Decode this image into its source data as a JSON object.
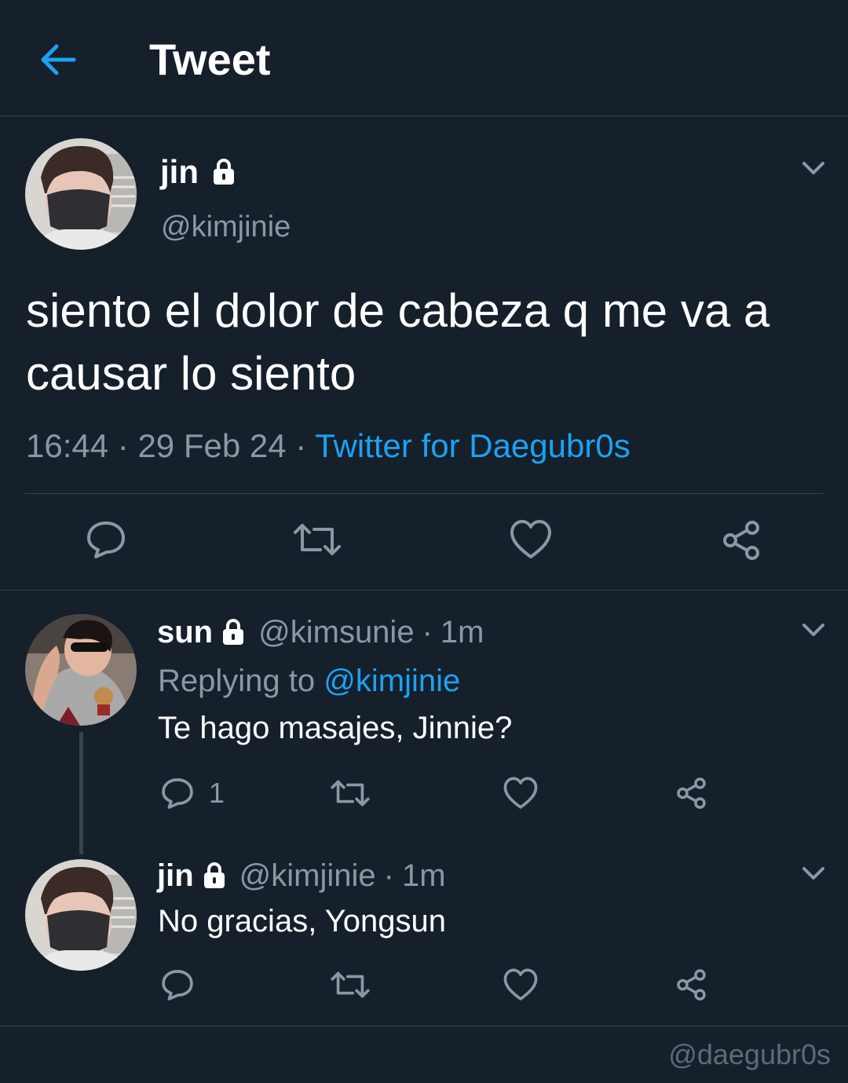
{
  "header": {
    "title": "Tweet",
    "back_icon": "arrow-left-icon",
    "accent_color": "#1da1f2"
  },
  "main_tweet": {
    "display_name": "jin",
    "handle": "@kimjinie",
    "protected_icon": "lock-icon",
    "text_line1": "siento el dolor de cabeza q me va a",
    "text_line2": "causar lo siento",
    "time": "16:44",
    "date": "29 Feb 24",
    "source": "Twitter for Daegubr0s",
    "separator": "·"
  },
  "replies": [
    {
      "display_name": "sun",
      "handle": "@kimsunie",
      "age": "1m",
      "replying_prefix": "Replying to",
      "replying_to": "@kimjinie",
      "text": "Te hago masajes, Jinnie?",
      "reply_count": "1"
    },
    {
      "display_name": "jin",
      "handle": "@kimjinie",
      "age": "1m",
      "text": "No gracias, Yongsun"
    }
  ],
  "watermark": "@daegubr0s",
  "colors": {
    "background": "#15202b",
    "muted": "#8899a6",
    "divider": "#38444d",
    "link": "#1da1f2"
  }
}
